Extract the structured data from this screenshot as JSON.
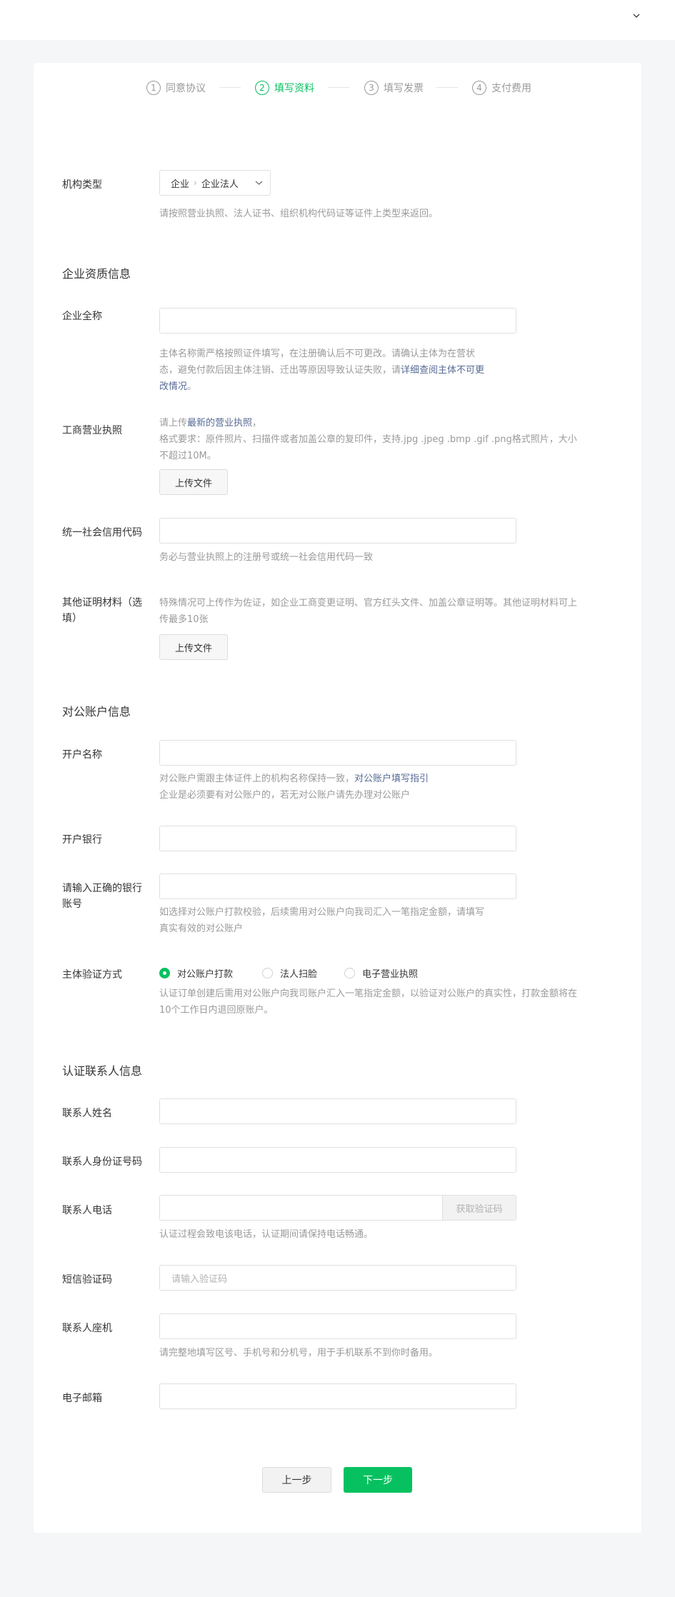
{
  "steps": [
    {
      "num": "1",
      "label": "同意协议"
    },
    {
      "num": "2",
      "label": "填写资料"
    },
    {
      "num": "3",
      "label": "填写发票"
    },
    {
      "num": "4",
      "label": "支付费用"
    }
  ],
  "org_type": {
    "label": "机构类型",
    "value1": "企业",
    "value2": "企业法人",
    "hint": "请按照营业执照、法人证书、组织机构代码证等证件上类型来返回。"
  },
  "sections": {
    "qualification": "企业资质信息",
    "account": "对公账户信息",
    "contact": "认证联系人信息"
  },
  "company_name": {
    "label": "企业全称",
    "hint_line1": "主体名称需严格按照证件填写，在注册确认后不可更改。请确认主体为在营状",
    "hint_line2_pre": "态，避免付款后因主体注销、迁出等原因导致认证失败，请",
    "hint_line2_link": "详细查阅主体不可更",
    "hint_line3_link": "改情况",
    "hint_line3_post": "。"
  },
  "license": {
    "label": "工商营业执照",
    "hint_pre": "请上传",
    "hint_link": "最新的营业执照",
    "hint_post": "，",
    "hint_line2": "格式要求：原件照片、扫描件或者加盖公章的复印件，支持.jpg .jpeg .bmp .gif .png格式照片，大小",
    "hint_line3": "不超过10M。",
    "upload_label": "上传文件"
  },
  "credit_code": {
    "label": "统一社会信用代码",
    "hint": "务必与营业执照上的注册号或统一社会信用代码一致"
  },
  "other_docs": {
    "label_line1": "其他证明材料（选",
    "label_line2": "填）",
    "hint_line1": "特殊情况可上传作为佐证，如企业工商变更证明、官方红头文件、加盖公章证明等。其他证明材料可上",
    "hint_line2": "传最多10张",
    "upload_label": "上传文件"
  },
  "account_name": {
    "label": "开户名称",
    "hint_pre": "对公账户需跟主体证件上的机构名称保持一致，",
    "hint_link": "对公账户填写指引",
    "hint_line2": "企业是必须要有对公账户的，若无对公账户请先办理对公账户"
  },
  "bank": {
    "label": "开户银行"
  },
  "bank_account": {
    "label_line1": "请输入正确的银行",
    "label_line2": "账号",
    "hint_line1": "如选择对公账户打款校验，后续需用对公账户向我司汇入一笔指定金额，请填写",
    "hint_line2": "真实有效的对公账户"
  },
  "verify_method": {
    "label": "主体验证方式",
    "options": [
      "对公账户打款",
      "法人扫脸",
      "电子营业执照"
    ],
    "selected": "对公账户打款",
    "hint_line1": "认证订单创建后需用对公账户向我司账户汇入一笔指定金额，以验证对公账户的真实性，打款金额将在",
    "hint_line2": "10个工作日内退回原账户。"
  },
  "contact_name": {
    "label": "联系人姓名"
  },
  "contact_id": {
    "label": "联系人身份证号码"
  },
  "contact_phone": {
    "label": "联系人电话",
    "code_button": "获取验证码",
    "hint": "认证过程会致电该电话，认证期间请保持电话畅通。"
  },
  "sms_code": {
    "label": "短信验证码",
    "placeholder": "请输入验证码"
  },
  "landline": {
    "label": "联系人座机",
    "hint": "请完整地填写区号、手机号和分机号，用于手机联系不到你时备用。"
  },
  "email": {
    "label": "电子邮箱"
  },
  "footer": {
    "prev": "上一步",
    "next": "下一步"
  },
  "colors": {
    "accent": "#07c160",
    "link": "#576b95",
    "hint": "#9a9a9a",
    "text": "#353535"
  }
}
